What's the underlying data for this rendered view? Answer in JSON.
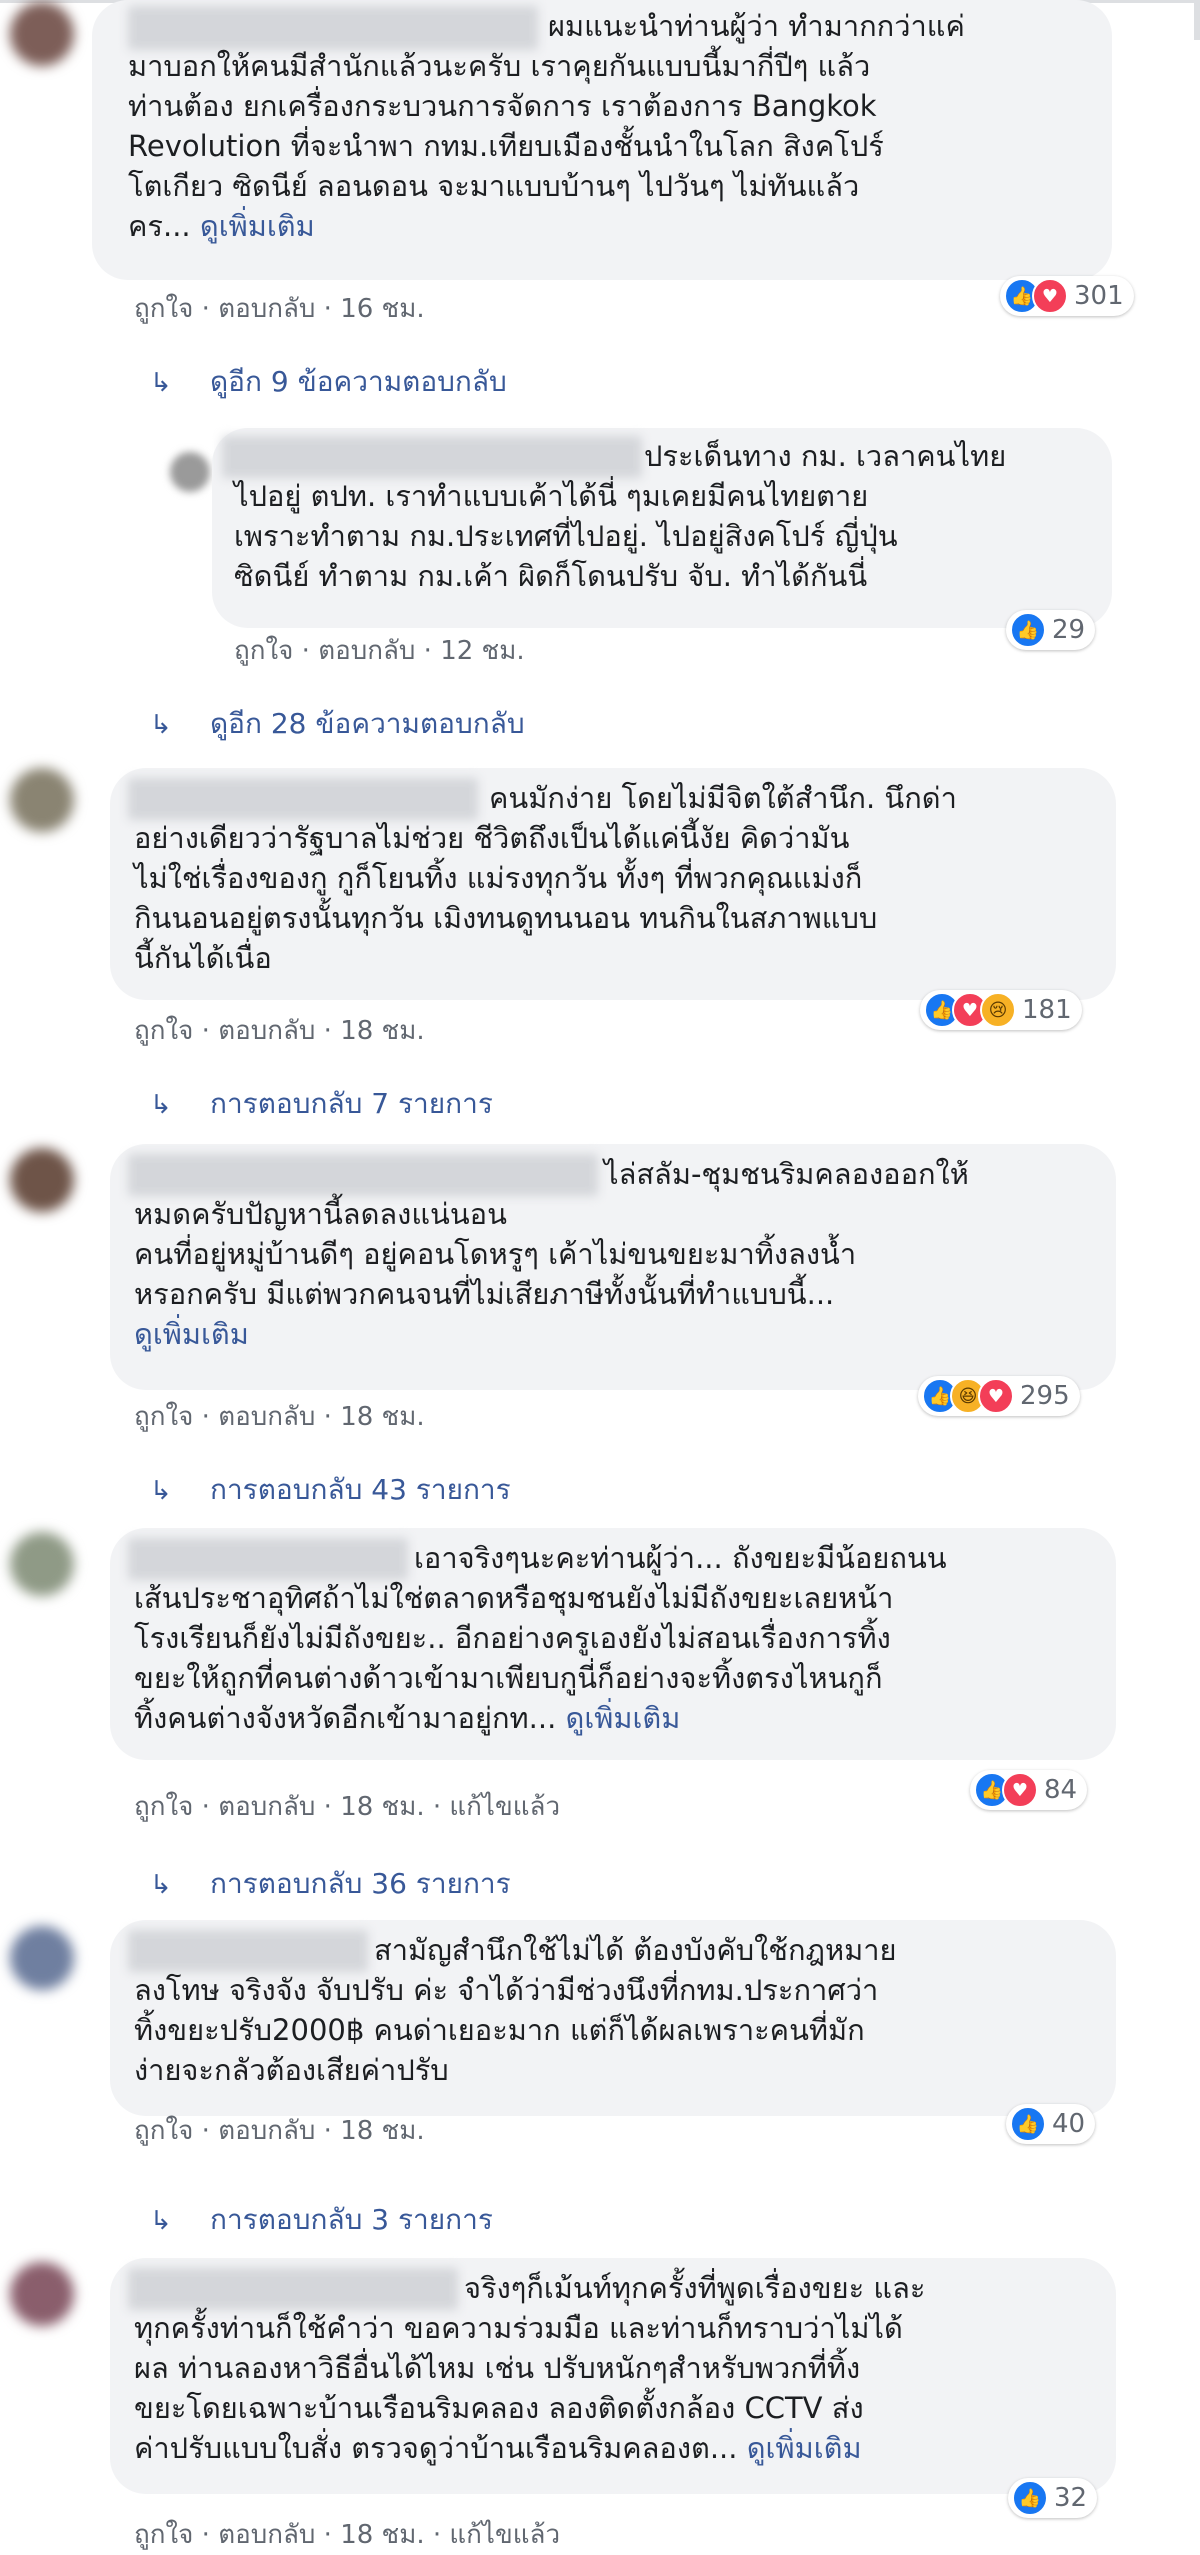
{
  "comments": [
    {
      "text": "ผมแนะนำท่านผู้ว่า ทำมากกว่าแค่\nมาบอกให้คนมีสำนักแล้วนะครับ เราคุยกันแบบนี้มากี่ปีๆ แล้ว\nท่านต้อง ยกเครื่องกระบวนการจัดการ เราต้องการ Bangkok\nRevolution ที่จะนำพา กทม.เทียบเมืองชั้นนำในโลก สิงคโปร์\nโตเกียว ซิดนีย์ ลอนดอน จะมาแบบบ้านๆ ไปวันๆ ไม่ทันแล้ว\nคร... ",
      "see_more": "ดูเพิ่มเติม",
      "actions": {
        "like": "ถูกใจ",
        "reply": "ตอบกลับ",
        "time": "16 ชม."
      },
      "reactions": {
        "icons": [
          "like-icon",
          "love-icon"
        ],
        "count": "301"
      },
      "replies_link": "ดูอีก 9 ข้อความตอบกลับ"
    },
    {
      "text": "ประเด็นทาง กม. เวลาคนไทย\nไปอยู่ ตปท. เราทำแบบเค้าได้นี่ ๆมเคยมีคนไทยตาย\nเพราะทำตาม กม.ประเทศที่ไปอยู่. ไปอยู่สิงคโปร์ ญี่ปุ่น\nซิดนีย์ ทำตาม กม.เค้า ผิดก็โดนปรับ จับ. ทำได้กันนี่",
      "actions": {
        "like": "ถูกใจ",
        "reply": "ตอบกลับ",
        "time": "12 ชม."
      },
      "reactions": {
        "icons": [
          "like-icon"
        ],
        "count": "29"
      },
      "replies_link": "ดูอีก 28 ข้อความตอบกลับ"
    },
    {
      "text": "คนมักง่าย โดยไม่มีจิตใต้สำนึก. นึกด่า\nอย่างเดียวว่ารัฐบาลไม่ช่วย ชีวิตถึงเป็นได้แค่นี้งัย คิดว่ามัน\nไม่ใช่เรื่องของกู กูก็โยนทิ้ง แม่รงทุกวัน ทั้งๆ ที่พวกคุณแม่งก็\nกินนอนอยู่ตรงนั้นทุกวัน เมิงทนดูทนนอน ทนกินในสภาพแบบ\nนี้กันได้เนื่อ",
      "actions": {
        "like": "ถูกใจ",
        "reply": "ตอบกลับ",
        "time": "18 ชม."
      },
      "reactions": {
        "icons": [
          "like-icon",
          "love-icon",
          "sad-icon"
        ],
        "count": "181"
      },
      "replies_link": "การตอบกลับ 7 รายการ"
    },
    {
      "text": "ไล่สลัม-ชุมชนริมคลองออกให้\nหมดครับปัญหานี้ลดลงแน่นอน\nคนที่อยู่หมู่บ้านดีๆ อยู่คอนโดหรูๆ เค้าไม่ขนขยะมาทิ้งลงน้ำ\nหรอกครับ มีแต่พวกคนจนที่ไม่เสียภาษีทั้งนั้นที่ทำแบบนี้...\n",
      "see_more": "ดูเพิ่มเติม",
      "actions": {
        "like": "ถูกใจ",
        "reply": "ตอบกลับ",
        "time": "18 ชม."
      },
      "reactions": {
        "icons": [
          "like-icon",
          "haha-icon",
          "love-icon"
        ],
        "count": "295"
      },
      "replies_link": "การตอบกลับ 43 รายการ"
    },
    {
      "text": "เอาจริงๆนะคะท่านผู้ว่า... ถังขยะมีน้อยถนน\nเส้นประชาอุทิศถ้าไม่ใช่ตลาดหรือชุมชนยังไม่มีถังขยะเลยหน้า\nโรงเรียนก็ยังไม่มีถังขยะ.. อีกอย่างครูเองยังไม่สอนเรื่องการทิ้ง\nขยะให้ถูกที่คนต่างด้าวเข้ามาเพียบกูนี่ก็อย่างจะทิ้งตรงไหนกูก็\nทิ้งคนต่างจังหวัดอีกเข้ามาอยู่กท... ",
      "see_more": "ดูเพิ่มเติม",
      "actions": {
        "like": "ถูกใจ",
        "reply": "ตอบกลับ",
        "time": "18 ชม.",
        "edited": "แก้ไขแล้ว"
      },
      "reactions": {
        "icons": [
          "like-icon",
          "love-icon"
        ],
        "count": "84"
      },
      "replies_link": "การตอบกลับ 36 รายการ"
    },
    {
      "text": "สามัญสำนึกใช้ไม่ได้ ต้องบังคับใช้กฎหมาย\nลงโทษ จริงจัง จับปรับ ค่ะ จำได้ว่ามีช่วงนึงที่กทม.ประกาศว่า\nทิ้งขยะปรับ2000฿ คนด่าเยอะมาก แต่ก็ได้ผลเพราะคนที่มัก\nง่ายจะกลัวต้องเสียค่าปรับ",
      "actions": {
        "like": "ถูกใจ",
        "reply": "ตอบกลับ",
        "time": "18 ชม."
      },
      "reactions": {
        "icons": [
          "like-icon"
        ],
        "count": "40"
      },
      "replies_link": "การตอบกลับ 3 รายการ"
    },
    {
      "text": "จริงๆก็เม้นท์ทุกครั้งที่พูดเรื่องขยะ และ\nทุกครั้งท่านก็ใช้คำว่า ขอความร่วมมือ และท่านก็ทราบว่าไม่ได้\nผล ท่านลองหาวิธีอื่นได้ไหม เช่น ปรับหนักๆสำหรับพวกที่ทิ้ง\nขยะโดยเฉพาะบ้านเรือนริมคลอง ลองติดตั้งกล้อง CCTV ส่ง\nค่าปรับแบบใบสั่ง ตรวจดูว่าบ้านเรือนริมคลองต... ",
      "see_more": "ดูเพิ่มเติม",
      "actions": {
        "like": "ถูกใจ",
        "reply": "ตอบกลับ",
        "time": "18 ชม.",
        "edited": "แก้ไขแล้ว"
      },
      "reactions": {
        "icons": [
          "like-icon"
        ],
        "count": "32"
      }
    }
  ],
  "separator": " · ",
  "reply_arrow": "↳",
  "colors": {
    "link": "#385898",
    "meta": "#616770",
    "bubble": "#f2f3f5",
    "like": "#1877f2",
    "love": "#f33e58"
  }
}
